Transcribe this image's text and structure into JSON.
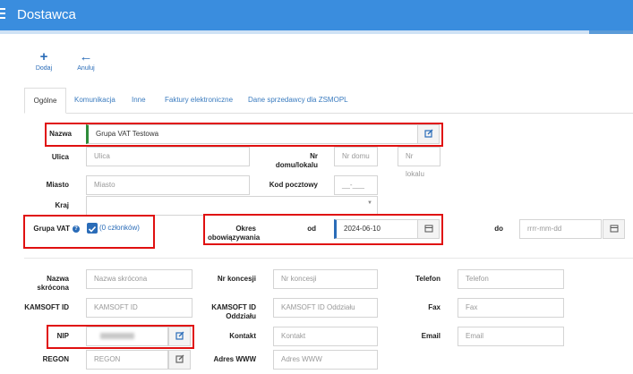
{
  "header": {
    "title": "Dostawca"
  },
  "toolbar": {
    "add_label": "Dodaj",
    "cancel_label": "Anuluj",
    "add_icon": "+",
    "back_icon": "←"
  },
  "tabs": [
    {
      "label": "Ogólne"
    },
    {
      "label": "Komunikacja"
    },
    {
      "label": "Inne"
    },
    {
      "label": "Faktury elektroniczne"
    },
    {
      "label": "Dane sprzedawcy dla ZSMOPL"
    }
  ],
  "form": {
    "nazwa": {
      "label": "Nazwa",
      "value": "Grupa VAT Testowa"
    },
    "ulica": {
      "label": "Ulica",
      "placeholder": "Ulica"
    },
    "nr": {
      "label1": "Nr",
      "label2": "domu/lokalu",
      "ph_domu": "Nr domu",
      "ph_lokalu": "Nr lokalu"
    },
    "miasto": {
      "label": "Miasto",
      "placeholder": "Miasto"
    },
    "kod": {
      "label": "Kod pocztowy",
      "placeholder": "__-___"
    },
    "kraj": {
      "label": "Kraj",
      "value": ""
    },
    "grupa_vat": {
      "label": "Grupa VAT",
      "members": "(0 członków)",
      "checked": true
    },
    "okres": {
      "label1": "Okres",
      "label2": "obowiązywania",
      "od_label": "od",
      "od_value": "2024-06-10",
      "do_label": "do",
      "do_placeholder": "rrrr-mm-dd"
    },
    "nazwa_skrocona": {
      "label1": "Nazwa",
      "label2": "skrócona",
      "placeholder": "Nazwa skrócona"
    },
    "nr_koncesji": {
      "label": "Nr koncesji",
      "placeholder": "Nr koncesji"
    },
    "telefon": {
      "label": "Telefon",
      "placeholder": "Telefon"
    },
    "kamsoft_id": {
      "label": "KAMSOFT ID",
      "placeholder": "KAMSOFT ID"
    },
    "kamsoft_oddzialu": {
      "label1": "KAMSOFT ID",
      "label2": "Oddziału",
      "placeholder": "KAMSOFT ID Oddziału"
    },
    "fax": {
      "label": "Fax",
      "placeholder": "Fax"
    },
    "nip": {
      "label": "NIP"
    },
    "kontakt": {
      "label": "Kontakt",
      "placeholder": "Kontakt"
    },
    "email": {
      "label": "Email",
      "placeholder": "Email"
    },
    "regon": {
      "label": "REGON",
      "placeholder": "REGON"
    },
    "www": {
      "label": "Adres WWW",
      "placeholder": "Adres WWW"
    }
  },
  "colors": {
    "header": "#3a8dde",
    "accent": "#2a6cb8",
    "highlight": "#e01010"
  }
}
